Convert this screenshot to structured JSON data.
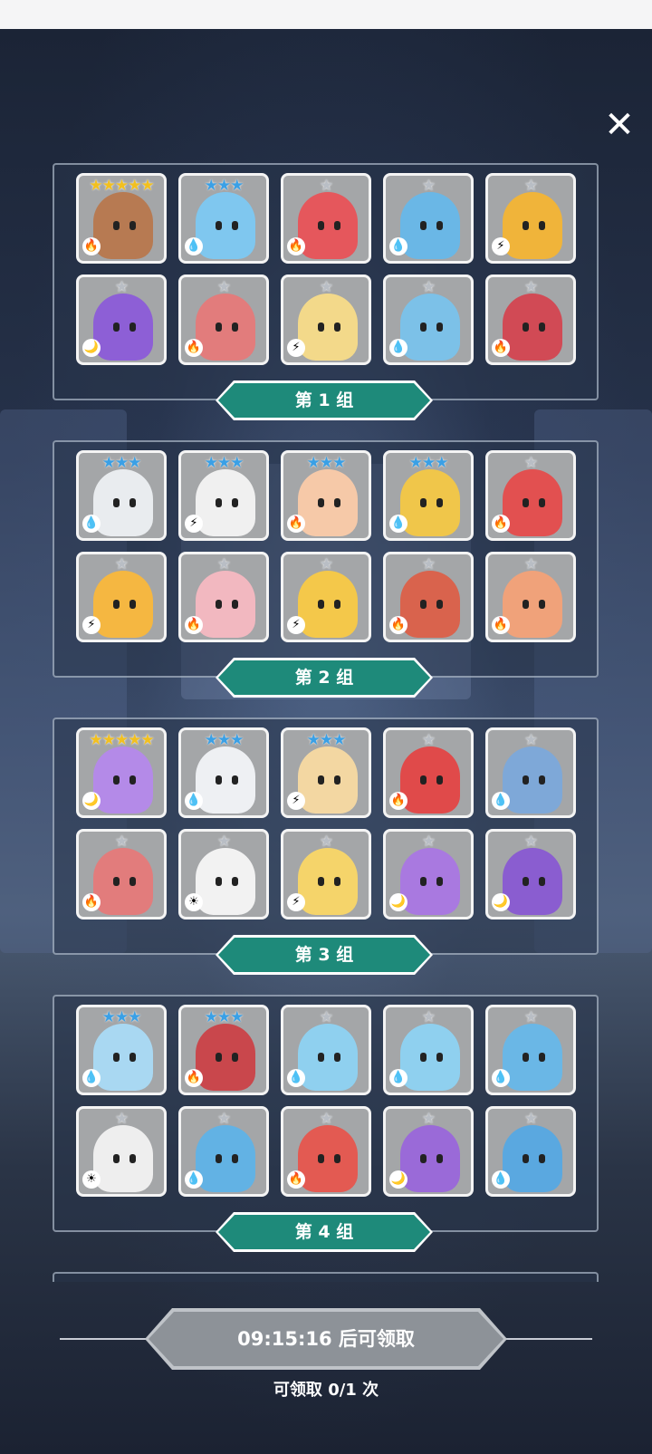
{
  "close_glyph": "✕",
  "groups": [
    {
      "label": "第 1 组",
      "cards": [
        {
          "stars": "★★★★★",
          "tier": "s5",
          "element": "🔥",
          "color": "#b77a52"
        },
        {
          "stars": "★★★",
          "tier": "s3",
          "element": "💧",
          "color": "#7fc7ef"
        },
        {
          "stars": "★",
          "tier": "s1",
          "element": "🔥",
          "color": "#e5575c"
        },
        {
          "stars": "★",
          "tier": "s1",
          "element": "💧",
          "color": "#6ab7e6"
        },
        {
          "stars": "★",
          "tier": "s1",
          "element": "⚡",
          "color": "#f0b43a"
        },
        {
          "stars": "★",
          "tier": "s1",
          "element": "🌙",
          "color": "#8d5fd6"
        },
        {
          "stars": "★",
          "tier": "s1",
          "element": "🔥",
          "color": "#e27c7c"
        },
        {
          "stars": "★",
          "tier": "s1",
          "element": "⚡",
          "color": "#f3d98a"
        },
        {
          "stars": "★",
          "tier": "s1",
          "element": "💧",
          "color": "#7cc1e8"
        },
        {
          "stars": "★",
          "tier": "s1",
          "element": "🔥",
          "color": "#d14a55"
        }
      ]
    },
    {
      "label": "第 2 组",
      "cards": [
        {
          "stars": "★★★",
          "tier": "s3",
          "element": "💧",
          "color": "#e9ecef"
        },
        {
          "stars": "★★★",
          "tier": "s3",
          "element": "⚡",
          "color": "#f0f0f0"
        },
        {
          "stars": "★★★",
          "tier": "s3",
          "element": "🔥",
          "color": "#f6c9a8"
        },
        {
          "stars": "★★★",
          "tier": "s3",
          "element": "💧",
          "color": "#f0c64a"
        },
        {
          "stars": "★",
          "tier": "s1",
          "element": "🔥",
          "color": "#e25050"
        },
        {
          "stars": "★",
          "tier": "s1",
          "element": "⚡",
          "color": "#f5b741"
        },
        {
          "stars": "★",
          "tier": "s1",
          "element": "🔥",
          "color": "#f2b8c0"
        },
        {
          "stars": "★",
          "tier": "s1",
          "element": "⚡",
          "color": "#f4c84a"
        },
        {
          "stars": "★",
          "tier": "s1",
          "element": "🔥",
          "color": "#d9634d"
        },
        {
          "stars": "★",
          "tier": "s1",
          "element": "🔥",
          "color": "#f0a27a"
        }
      ]
    },
    {
      "label": "第 3 组",
      "cards": [
        {
          "stars": "★★★★★",
          "tier": "s5",
          "element": "🌙",
          "color": "#b48ae8"
        },
        {
          "stars": "★★★",
          "tier": "s3",
          "element": "💧",
          "color": "#eef0f3"
        },
        {
          "stars": "★★★",
          "tier": "s3",
          "element": "⚡",
          "color": "#f3d7a2"
        },
        {
          "stars": "★",
          "tier": "s1",
          "element": "🔥",
          "color": "#e04a4a"
        },
        {
          "stars": "★",
          "tier": "s1",
          "element": "💧",
          "color": "#7ea8d8"
        },
        {
          "stars": "★",
          "tier": "s1",
          "element": "🔥",
          "color": "#e27c7c"
        },
        {
          "stars": "★",
          "tier": "s1",
          "element": "☀",
          "color": "#f2f2f2"
        },
        {
          "stars": "★",
          "tier": "s1",
          "element": "⚡",
          "color": "#f5d46a"
        },
        {
          "stars": "★",
          "tier": "s1",
          "element": "🌙",
          "color": "#a979e0"
        },
        {
          "stars": "★",
          "tier": "s1",
          "element": "🌙",
          "color": "#8a5dd0"
        }
      ]
    },
    {
      "label": "第 4 组",
      "cards": [
        {
          "stars": "★★★",
          "tier": "s3",
          "element": "💧",
          "color": "#a9d8f2"
        },
        {
          "stars": "★★★",
          "tier": "s3",
          "element": "🔥",
          "color": "#c9474c"
        },
        {
          "stars": "★",
          "tier": "s1",
          "element": "💧",
          "color": "#8fd0ef"
        },
        {
          "stars": "★",
          "tier": "s1",
          "element": "💧",
          "color": "#8fd0ef"
        },
        {
          "stars": "★",
          "tier": "s1",
          "element": "💧",
          "color": "#6ab7e6"
        },
        {
          "stars": "★",
          "tier": "s1",
          "element": "☀",
          "color": "#eeeeee"
        },
        {
          "stars": "★",
          "tier": "s1",
          "element": "💧",
          "color": "#62b2e4"
        },
        {
          "stars": "★",
          "tier": "s1",
          "element": "🔥",
          "color": "#e35a52"
        },
        {
          "stars": "★",
          "tier": "s1",
          "element": "🌙",
          "color": "#9a6ad8"
        },
        {
          "stars": "★",
          "tier": "s1",
          "element": "💧",
          "color": "#5aa8e0"
        }
      ]
    }
  ],
  "claim_button": "09:15:16 后可领取",
  "claim_count": "可领取 0/1 次"
}
